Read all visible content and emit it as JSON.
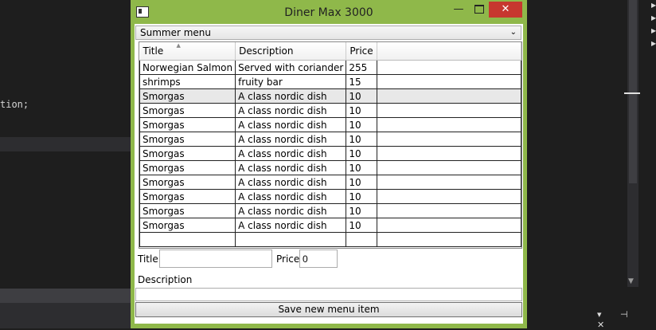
{
  "ide": {
    "code_line": "tion;",
    "right_tools": "▾ ⊣ ✕"
  },
  "window": {
    "title": "Diner Max 3000",
    "minimize_label": "—",
    "close_label": "✕"
  },
  "menu_select": {
    "value": "Summer menu"
  },
  "grid": {
    "columns": [
      "Title",
      "Description",
      "Price"
    ],
    "rows": [
      {
        "title": "Norwegian Salmon",
        "description": "Served with coriander",
        "price": "255"
      },
      {
        "title": "shrimps",
        "description": "fruity bar",
        "price": "15"
      },
      {
        "title": "Smorgas",
        "description": "A class nordic dish",
        "price": "10"
      },
      {
        "title": "Smorgas",
        "description": "A class nordic dish",
        "price": "10"
      },
      {
        "title": "Smorgas",
        "description": "A class nordic dish",
        "price": "10"
      },
      {
        "title": "Smorgas",
        "description": "A class nordic dish",
        "price": "10"
      },
      {
        "title": "Smorgas",
        "description": "A class nordic dish",
        "price": "10"
      },
      {
        "title": "Smorgas",
        "description": "A class nordic dish",
        "price": "10"
      },
      {
        "title": "Smorgas",
        "description": "A class nordic dish",
        "price": "10"
      },
      {
        "title": "Smorgas",
        "description": "A class nordic dish",
        "price": "10"
      },
      {
        "title": "Smorgas",
        "description": "A class nordic dish",
        "price": "10"
      },
      {
        "title": "Smorgas",
        "description": "A class nordic dish",
        "price": "10"
      }
    ]
  },
  "form": {
    "title_label": "Title",
    "title_value": "",
    "price_label": "Price",
    "price_value": "0",
    "description_label": "Description",
    "description_value": "",
    "save_label": "Save new menu item"
  }
}
